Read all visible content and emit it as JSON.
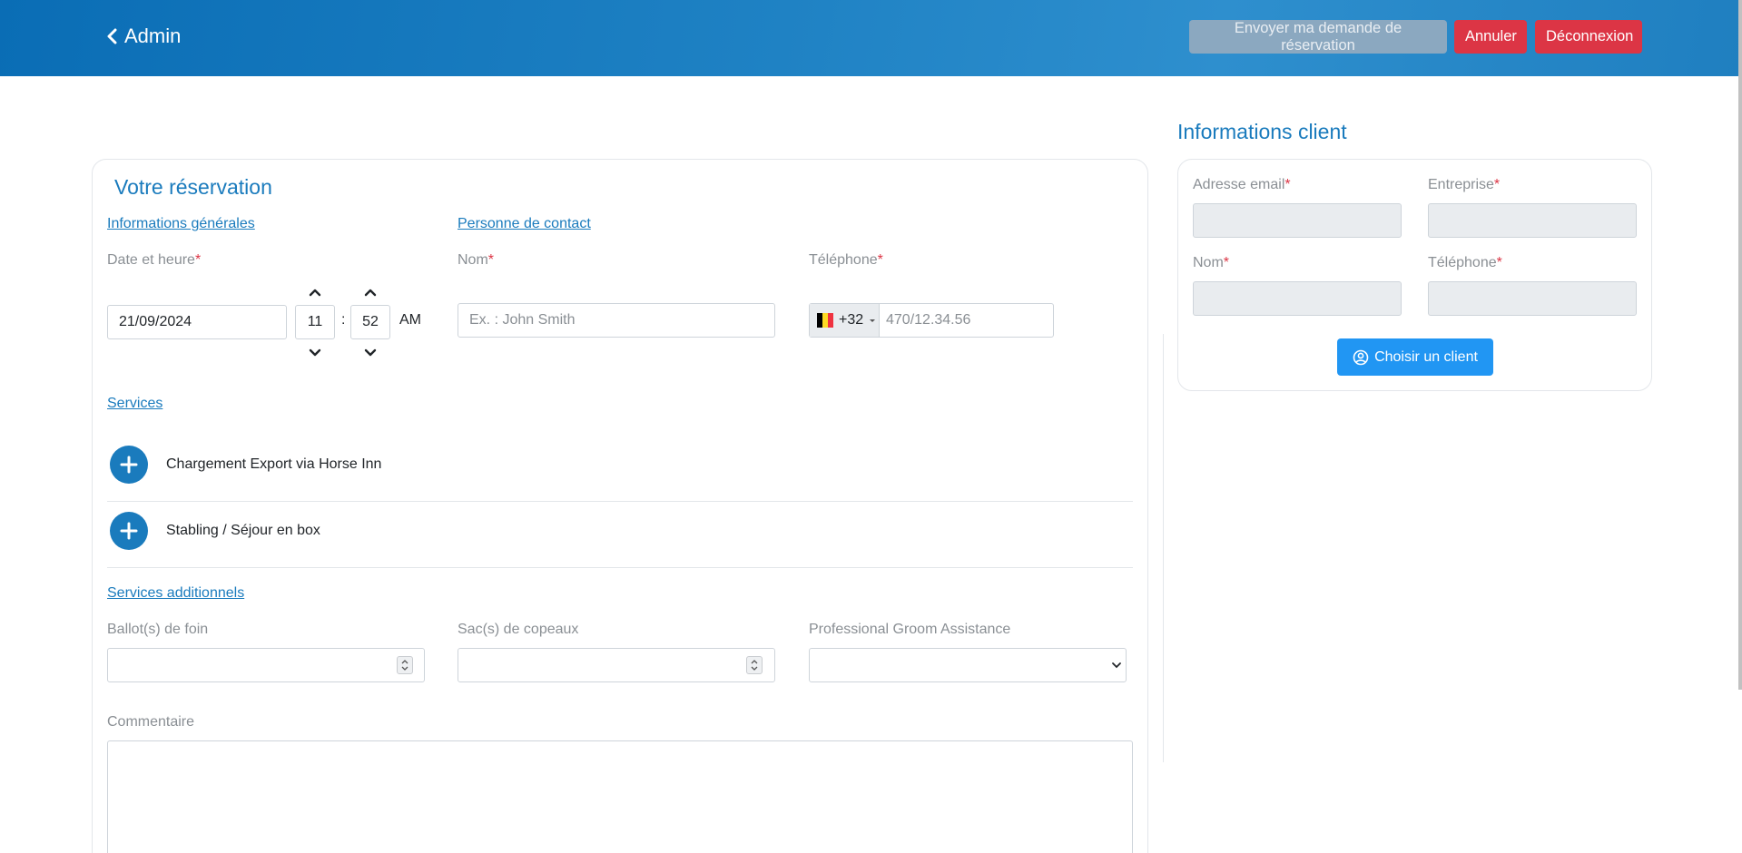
{
  "header": {
    "back_label": "Admin",
    "send_label": "Envoyer ma demande de réservation",
    "cancel_label": "Annuler",
    "logout_label": "Déconnexion"
  },
  "reservation": {
    "title": "Votre réservation",
    "general_info_link": "Informations générales",
    "contact_link": "Personne de contact",
    "date_label": "Date et heure",
    "date_value": "21/09/2024",
    "hour": "11",
    "minute": "52",
    "colon": ":",
    "ampm": "AM",
    "name_label": "Nom",
    "name_placeholder": "Ex. : John Smith",
    "phone_label": "Téléphone",
    "phone_code": "+32",
    "phone_placeholder": "470/12.34.56",
    "required_mark": "*"
  },
  "services": {
    "link": "Services",
    "items": [
      {
        "label": "Chargement Export via Horse Inn"
      },
      {
        "label": "Stabling / Séjour en box"
      }
    ]
  },
  "additional": {
    "link": "Services additionnels",
    "hay_label": "Ballot(s) de foin",
    "shavings_label": "Sac(s) de copeaux",
    "groom_label": "Professional Groom Assistance",
    "comment_label": "Commentaire"
  },
  "client": {
    "title": "Informations client",
    "email_label": "Adresse email",
    "company_label": "Entreprise",
    "name_label": "Nom",
    "phone_label": "Téléphone",
    "choose_label": "Choisir un client"
  },
  "colors": {
    "primary": "#1a7bbd",
    "danger": "#dc3545",
    "button_blue": "#2196f3"
  }
}
